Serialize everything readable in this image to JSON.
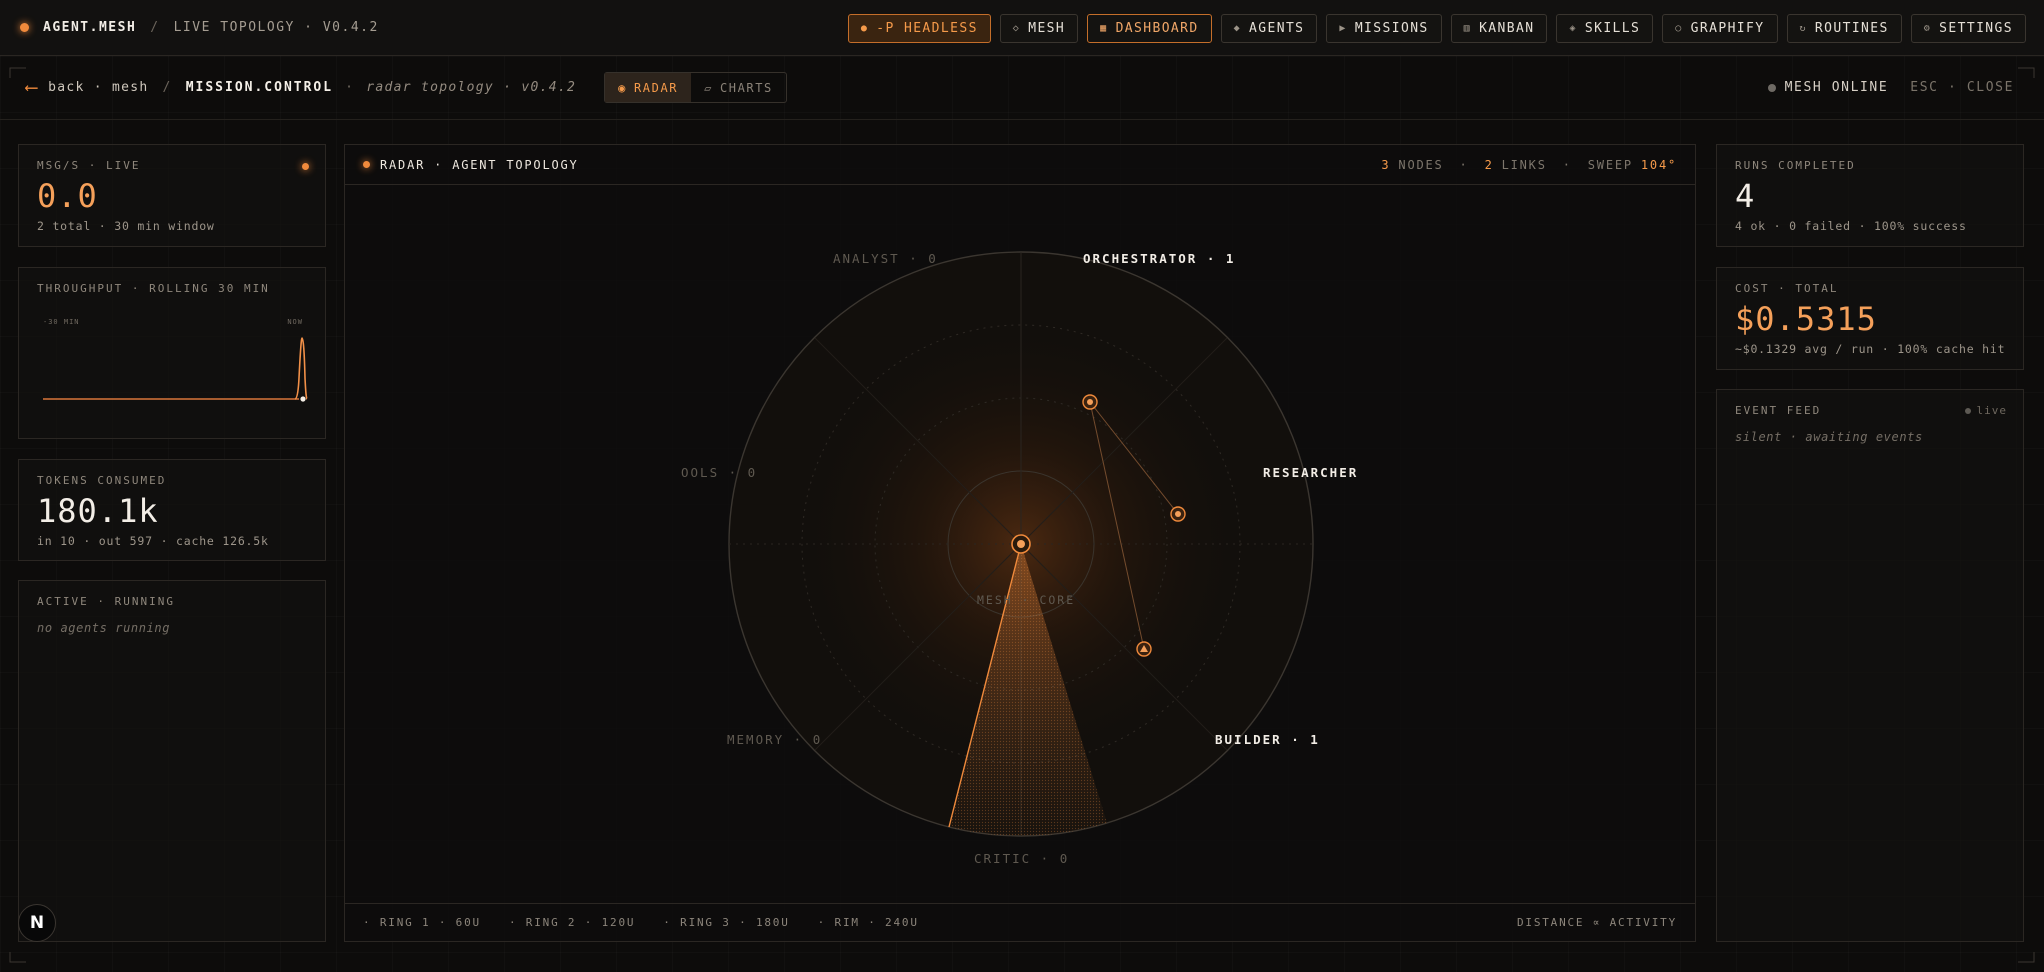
{
  "brand": {
    "name": "AGENT.MESH",
    "separator": "/",
    "subtitle": "LIVE TOPOLOGY · V0.4.2"
  },
  "nav": [
    {
      "label": "-P HEADLESS",
      "icon": "dot-icon",
      "glyph": "●",
      "style": "accent"
    },
    {
      "label": "MESH",
      "icon": "diamond-icon",
      "glyph": "◇",
      "style": ""
    },
    {
      "label": "DASHBOARD",
      "icon": "grid-icon",
      "glyph": "▦",
      "style": "outlined"
    },
    {
      "label": "AGENTS",
      "icon": "agents-icon",
      "glyph": "◆",
      "style": ""
    },
    {
      "label": "MISSIONS",
      "icon": "play-icon",
      "glyph": "▶",
      "style": ""
    },
    {
      "label": "KANBAN",
      "icon": "kanban-icon",
      "glyph": "▥",
      "style": ""
    },
    {
      "label": "SKILLS",
      "icon": "skills-icon",
      "glyph": "◈",
      "style": ""
    },
    {
      "label": "GRAPHIFY",
      "icon": "graph-icon",
      "glyph": "○",
      "style": ""
    },
    {
      "label": "ROUTINES",
      "icon": "refresh-icon",
      "glyph": "↻",
      "style": ""
    },
    {
      "label": "SETTINGS",
      "icon": "gear-icon",
      "glyph": "⚙",
      "style": ""
    }
  ],
  "subbar": {
    "back_arrow": "⟵",
    "back_label": "back · mesh",
    "sep": "/",
    "title": "MISSION.CONTROL",
    "dot": "·",
    "topology_label": "radar topology · v0.4.2",
    "tabs": [
      {
        "label": "RADAR",
        "glyph": "◉"
      },
      {
        "label": "CHARTS",
        "glyph": "▱"
      }
    ],
    "mesh_status": "MESH ONLINE",
    "close_label": "ESC · CLOSE"
  },
  "left": {
    "msgs": {
      "label": "MSG/S · LIVE",
      "value": "0.0",
      "detail": "2 total · 30 min window"
    },
    "throughput": {
      "label": "THROUGHPUT · ROLLING 30 MIN",
      "x_start": "-30 MIN",
      "x_end": "NOW"
    },
    "tokens": {
      "label": "TOKENS CONSUMED",
      "value": "180.1k",
      "detail": "in 10 · out 597 · cache 126.5k"
    },
    "active": {
      "label": "ACTIVE · RUNNING",
      "empty": "no agents running"
    }
  },
  "radar": {
    "header_title": "RADAR · AGENT TOPOLOGY",
    "nodes_count": "3",
    "nodes_label": "NODES",
    "links_count": "2",
    "links_label": "LINKS",
    "sweep_label": "SWEEP",
    "sweep_value": "104°",
    "core_label": "MESH · CORE",
    "labels": {
      "analyst": "ANALYST · 0",
      "orchestrator": "ORCHESTRATOR · 1",
      "tools": "OOLS · 0",
      "researcher": "RESEARCHER",
      "memory": "MEMORY · 0",
      "builder": "BUILDER · 1",
      "critic": "CRITIC · 0"
    },
    "rings": [
      "RING 1 · 60U",
      "RING 2 · 120U",
      "RING 3 · 180U",
      "RIM · 240U"
    ],
    "distance_note": "DISTANCE ∝ ACTIVITY"
  },
  "right": {
    "runs": {
      "label": "RUNS COMPLETED",
      "value": "4",
      "detail": "4 ok · 0 failed · 100% success"
    },
    "cost": {
      "label": "COST · TOTAL",
      "value": "$0.5315",
      "detail": "~$0.1329 avg / run · 100% cache hit"
    },
    "events": {
      "label": "EVENT FEED",
      "live": "live",
      "empty": "silent · awaiting events"
    }
  },
  "fab": {
    "label": "N"
  },
  "colors": {
    "accent": "#f08a3c",
    "bg": "#0d0c0b",
    "text": "#f2ede6"
  }
}
